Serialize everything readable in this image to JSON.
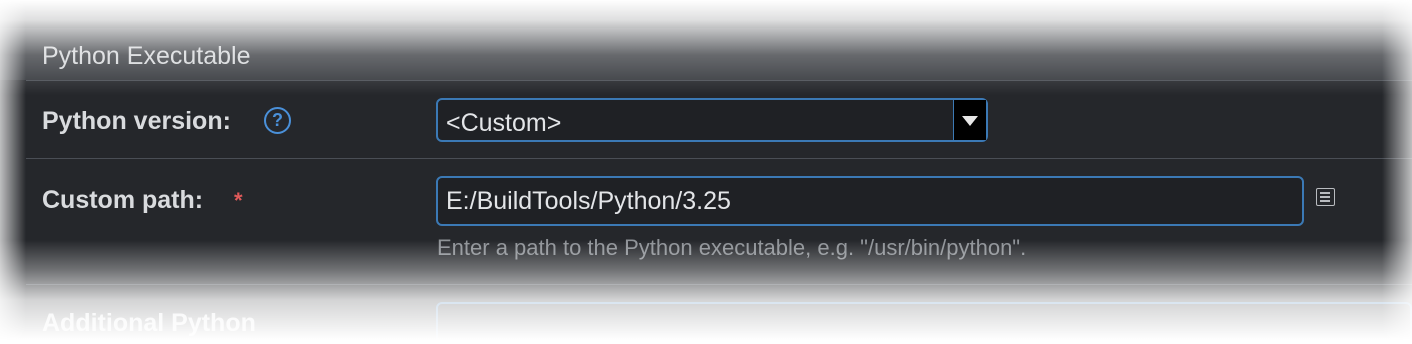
{
  "section": {
    "title": "Python Executable"
  },
  "python_version": {
    "label": "Python version:",
    "help_icon": "question-circle-icon",
    "selected": "<Custom>"
  },
  "custom_path": {
    "label": "Custom path:",
    "required_mark": "*",
    "value": "E:/BuildTools/Python/3.25",
    "hint": "Enter a path to the Python executable, e.g. \"/usr/bin/python\".",
    "browse_icon": "list-icon"
  },
  "next_field": {
    "label": "Additional Python"
  },
  "colors": {
    "panel_bg": "#25272b",
    "accent": "#3b79b5",
    "help": "#4a90d9",
    "required": "#e05a5a"
  }
}
